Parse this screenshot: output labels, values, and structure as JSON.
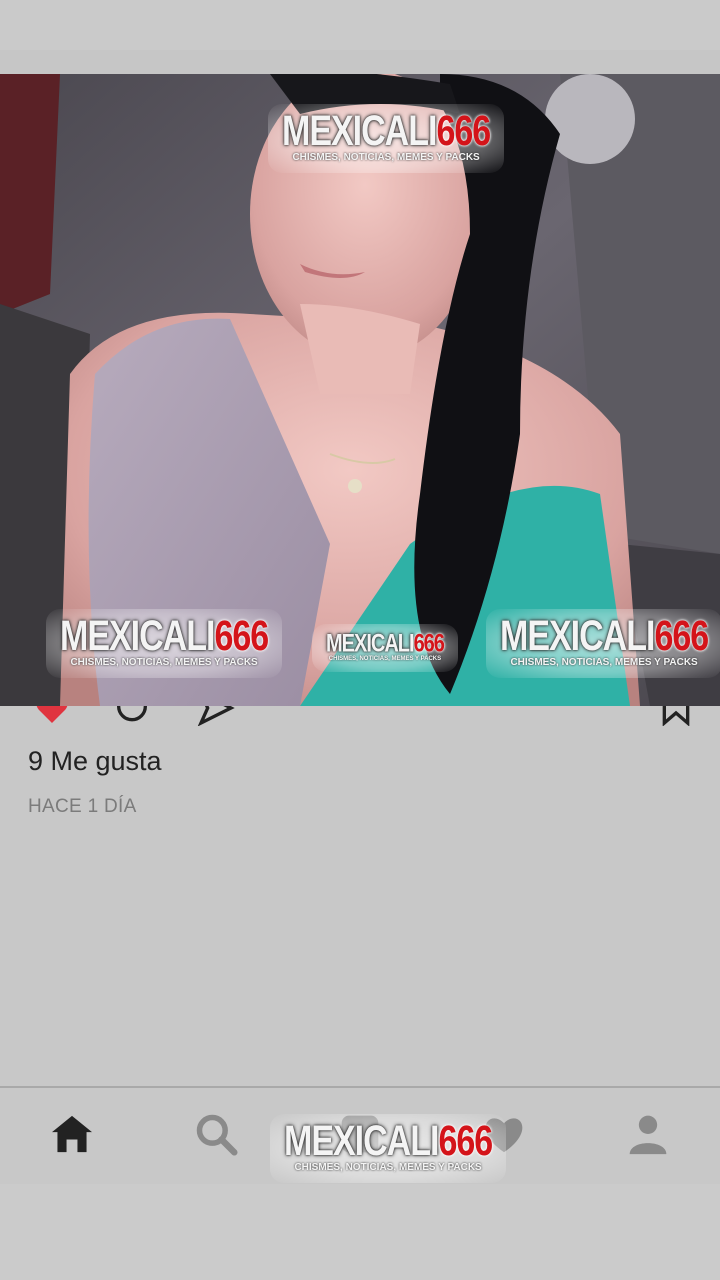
{
  "post": {
    "likes_text": "9 Me gusta",
    "time_text": "HACE 1 DÍA"
  },
  "watermark": {
    "brand_a": "MEXICALI",
    "brand_b": "666",
    "tagline": "CHISMES, NOTICIAS, MEMES Y PACKS"
  },
  "icons": {
    "like": "heart-filled-icon",
    "comment": "comment-icon",
    "share": "send-icon",
    "save": "bookmark-icon",
    "home": "home-icon",
    "search": "search-icon",
    "add": "add-post-icon",
    "activity": "heart-icon",
    "profile": "profile-icon"
  },
  "colors": {
    "background": "#c8c8c8",
    "like_red": "#e0343f",
    "watermark_red": "#d4141a",
    "nav_active": "#222222",
    "nav_inactive": "#8a8a8a"
  }
}
